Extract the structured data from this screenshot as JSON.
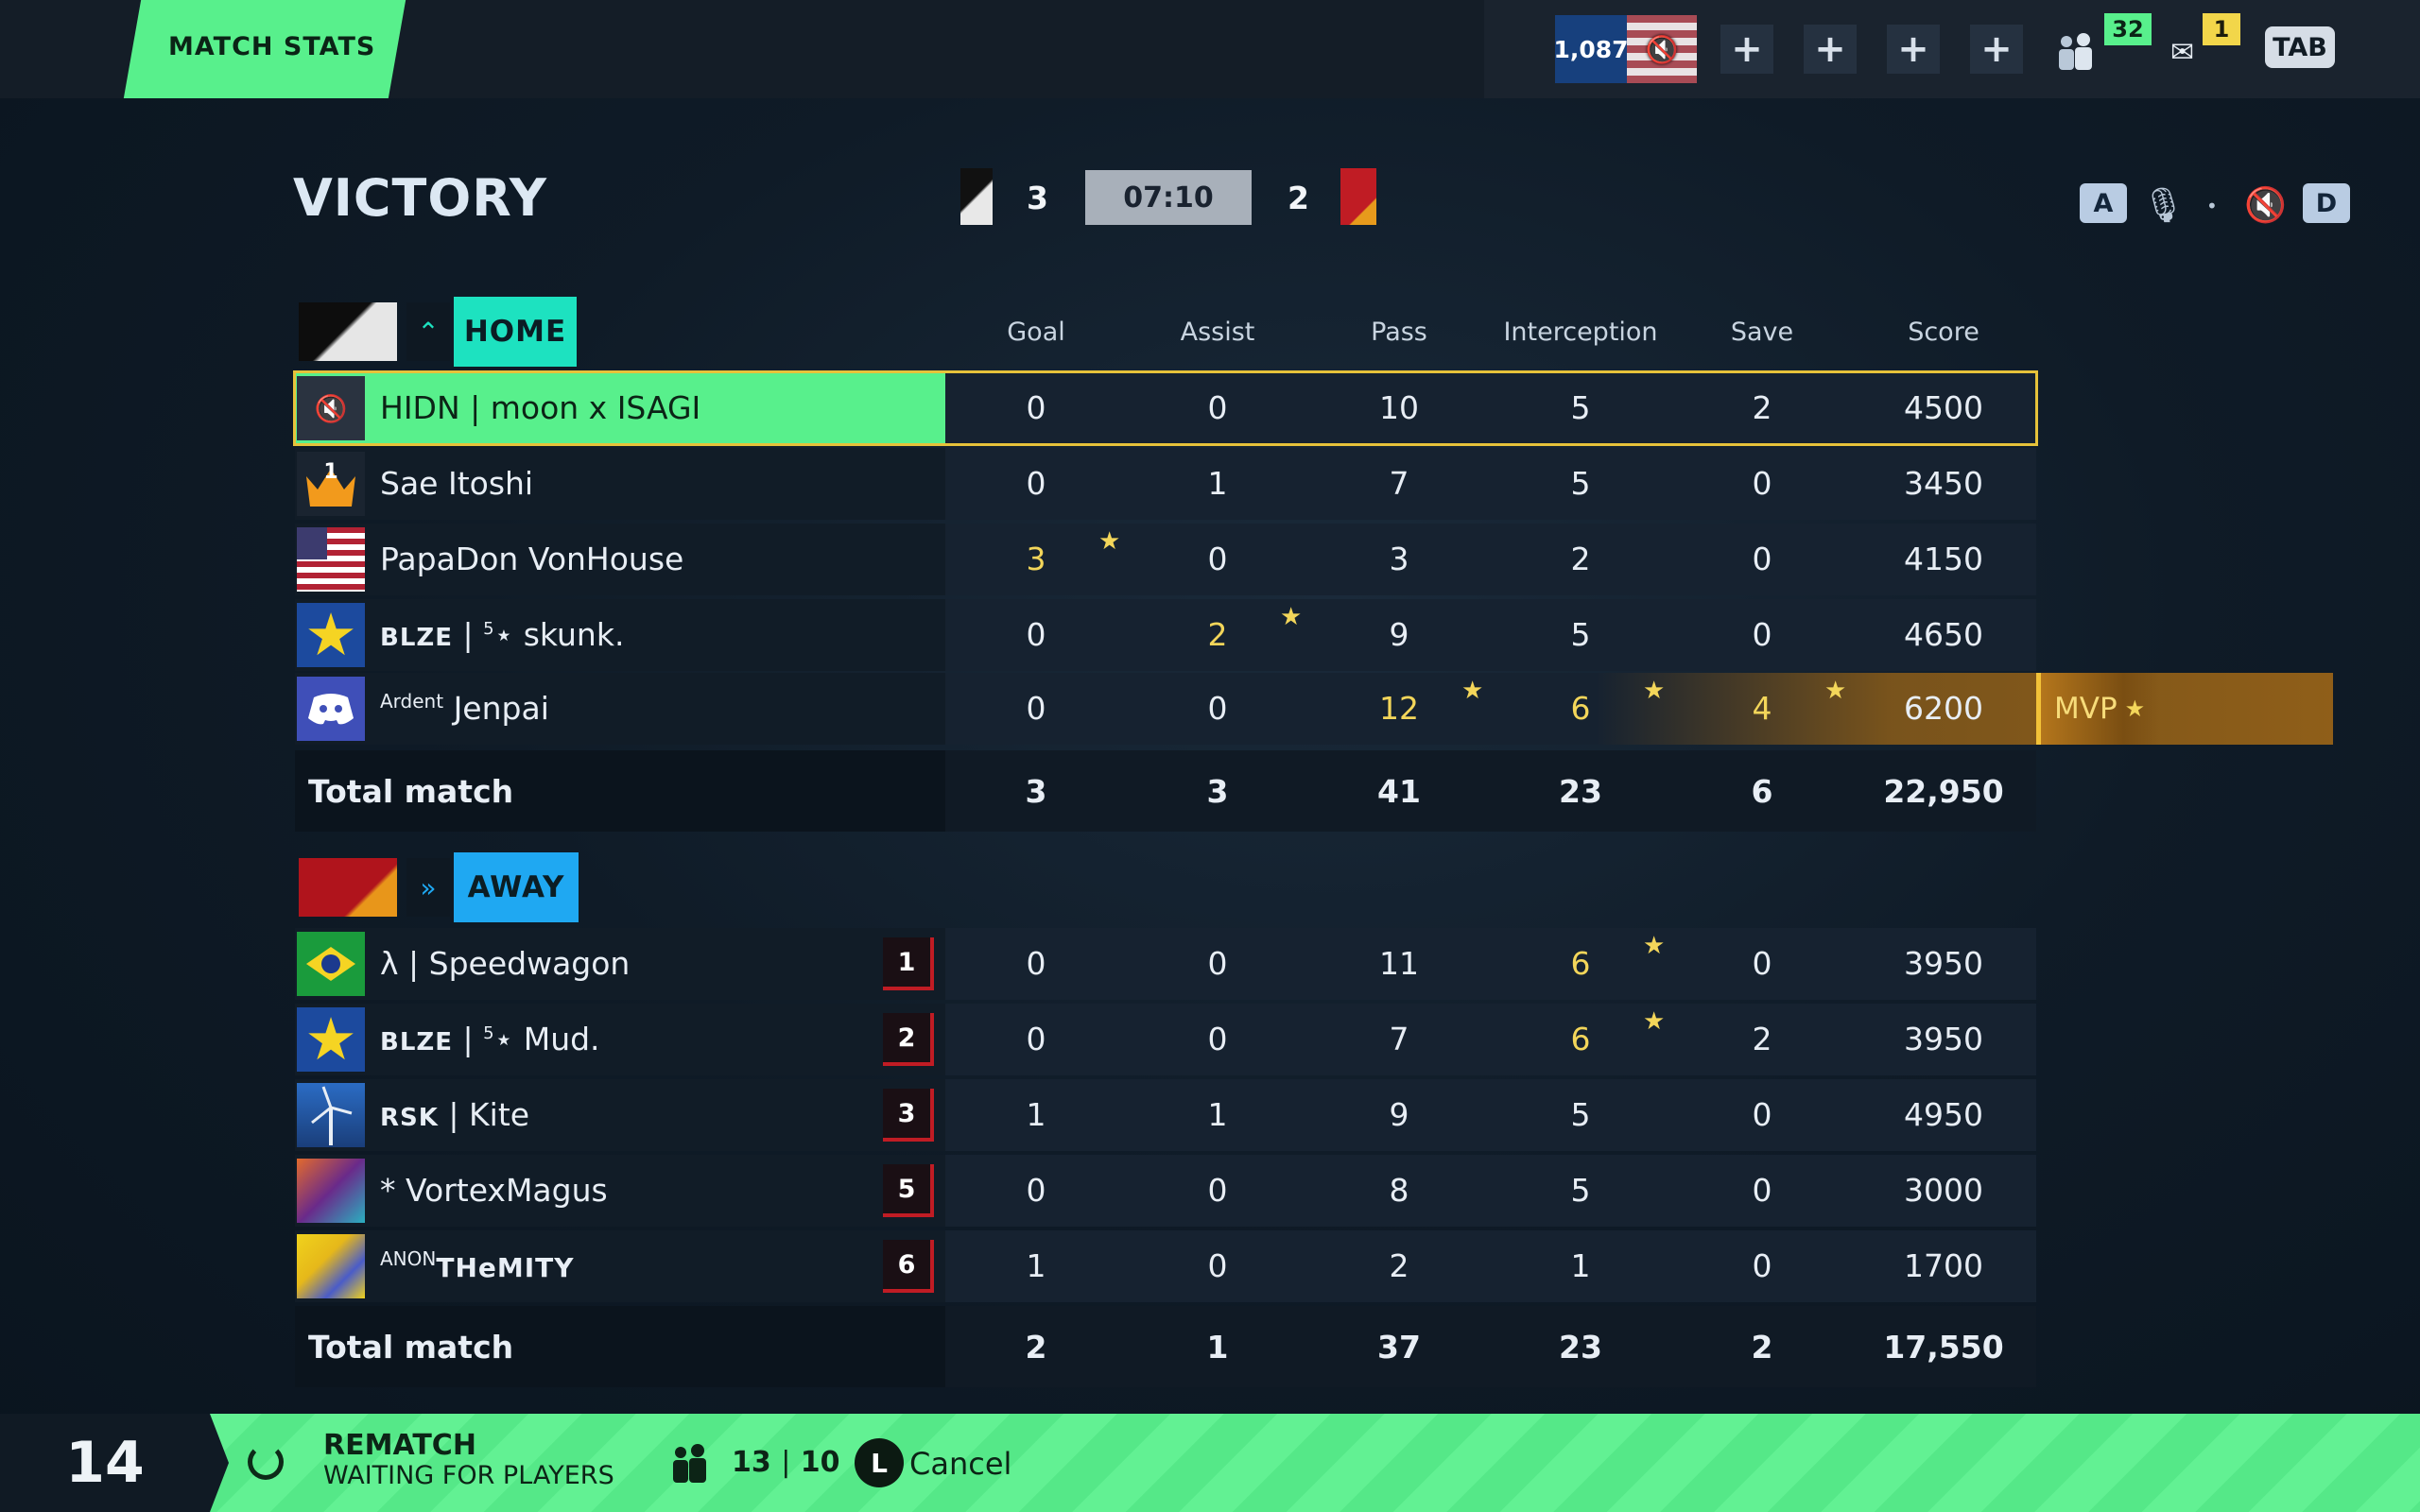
{
  "header": {
    "tab_label": "MATCH STATS",
    "currency": "1,087",
    "friends_count": "32",
    "mail_count": "1",
    "tab_key": "TAB"
  },
  "scoreboard": {
    "result": "VICTORY",
    "home_score": "3",
    "timer": "07:10",
    "away_score": "2",
    "key_left": "A",
    "key_right": "D"
  },
  "columns": [
    "Goal",
    "Assist",
    "Pass",
    "Interception",
    "Save",
    "Score"
  ],
  "home": {
    "label": "HOME",
    "players": [
      {
        "name": "HIDN | moon x ISAGI",
        "stats": [
          "0",
          "0",
          "10",
          "5",
          "2",
          "4500"
        ]
      },
      {
        "name": "Sae Itoshi",
        "stats": [
          "0",
          "1",
          "7",
          "5",
          "0",
          "3450"
        ]
      },
      {
        "name": "PapaDon VonHouse",
        "stats": [
          "3",
          "0",
          "3",
          "2",
          "0",
          "4150"
        ]
      },
      {
        "tag": "BLZE",
        "sup": "5",
        "name": "skunk.",
        "stats": [
          "0",
          "2",
          "9",
          "5",
          "0",
          "4650"
        ]
      },
      {
        "prefix": "Ardent",
        "name": "Jenpai",
        "stats": [
          "0",
          "0",
          "12",
          "6",
          "4",
          "6200"
        ],
        "badge": "MVP"
      }
    ],
    "total_label": "Total match",
    "totals": [
      "3",
      "3",
      "41",
      "23",
      "6",
      "22,950"
    ]
  },
  "away": {
    "label": "AWAY",
    "players": [
      {
        "name": "λ | Speedwagon",
        "rank": "1",
        "stats": [
          "0",
          "0",
          "11",
          "6",
          "0",
          "3950"
        ]
      },
      {
        "tag": "BLZE",
        "sup": "5",
        "name": "Mud.",
        "rank": "2",
        "stats": [
          "0",
          "0",
          "7",
          "6",
          "2",
          "3950"
        ]
      },
      {
        "tag": "RSK",
        "name": "Kite",
        "rank": "3",
        "stats": [
          "1",
          "1",
          "9",
          "5",
          "0",
          "4950"
        ]
      },
      {
        "name": "* VortexMagus",
        "rank": "5",
        "stats": [
          "0",
          "0",
          "8",
          "5",
          "0",
          "3000"
        ]
      },
      {
        "prefix": "ANON",
        "name": "THeMITY",
        "rank": "6",
        "stats": [
          "1",
          "0",
          "2",
          "1",
          "0",
          "1700"
        ]
      }
    ],
    "total_label": "Total match",
    "totals": [
      "2",
      "1",
      "37",
      "23",
      "2",
      "17,550"
    ]
  },
  "footer": {
    "round": "14",
    "title": "REMATCH",
    "subtitle": "WAITING FOR PLAYERS",
    "ready": "13",
    "total": "10",
    "cancel_key": "L",
    "cancel_label": "Cancel"
  },
  "colors": {
    "accent_green": "#58f08c",
    "home_team": "#1de2c0",
    "away_team": "#1fa8f2",
    "highlight_gold": "#f3d65a",
    "mvp_orange": "#b4761c"
  }
}
